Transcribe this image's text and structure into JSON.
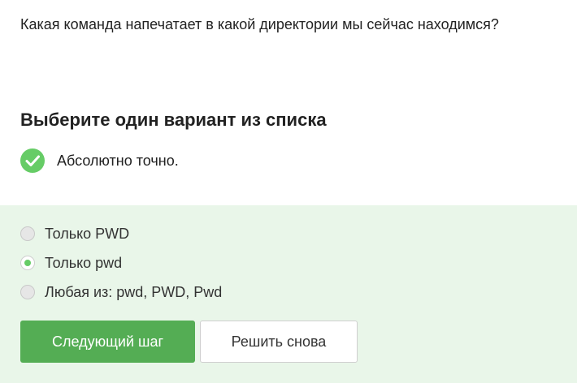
{
  "question": {
    "text": "Какая команда напечатает в какой директории мы сейчас находимся?"
  },
  "section": {
    "title": "Выберите один вариант из списка"
  },
  "feedback": {
    "icon": "check-circle-icon",
    "text": "Абсолютно точно.",
    "color": "#66cc66"
  },
  "options": [
    {
      "label": "Только PWD",
      "selected": false
    },
    {
      "label": "Только pwd",
      "selected": true
    },
    {
      "label": "Любая из: pwd, PWD, Pwd",
      "selected": false
    }
  ],
  "buttons": {
    "next_label": "Следующий шаг",
    "retry_label": "Решить снова"
  },
  "colors": {
    "panel_background": "#e9f6e9",
    "primary_button": "#54ad54",
    "accent": "#66cc66"
  }
}
